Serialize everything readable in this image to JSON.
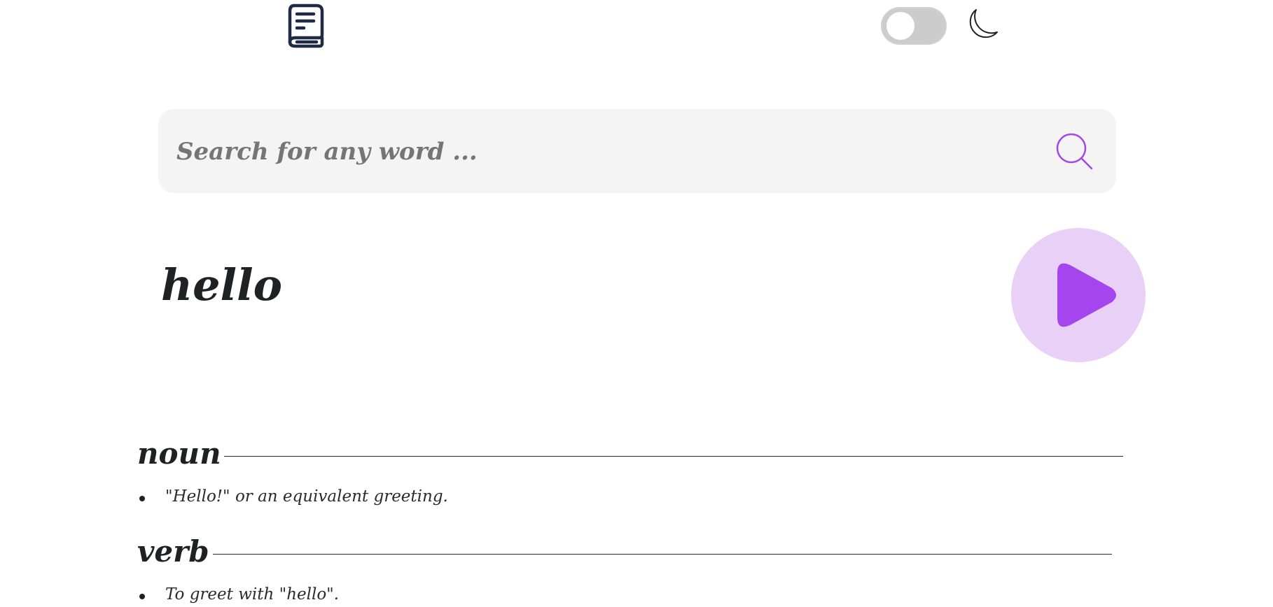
{
  "header": {
    "logo_icon": "book-icon",
    "theme_toggle": {
      "state": "off",
      "icon": "moon-icon"
    }
  },
  "search": {
    "placeholder": "Search for any word ...",
    "value": "",
    "icon": "search-icon",
    "accent": "#a445ed"
  },
  "entry": {
    "word": "hello",
    "play_icon": "play-icon",
    "meanings": [
      {
        "part_of_speech": "noun",
        "definitions": [
          "\"Hello!\" or an equivalent greeting."
        ]
      },
      {
        "part_of_speech": "verb",
        "definitions": [
          "To greet with \"hello\"."
        ]
      }
    ]
  },
  "colors": {
    "accent": "#a445ed",
    "accent_light": "#e9d0f6",
    "text": "#1f2125",
    "search_bg": "#f4f4f4",
    "toggle_bg": "#cccccc"
  }
}
